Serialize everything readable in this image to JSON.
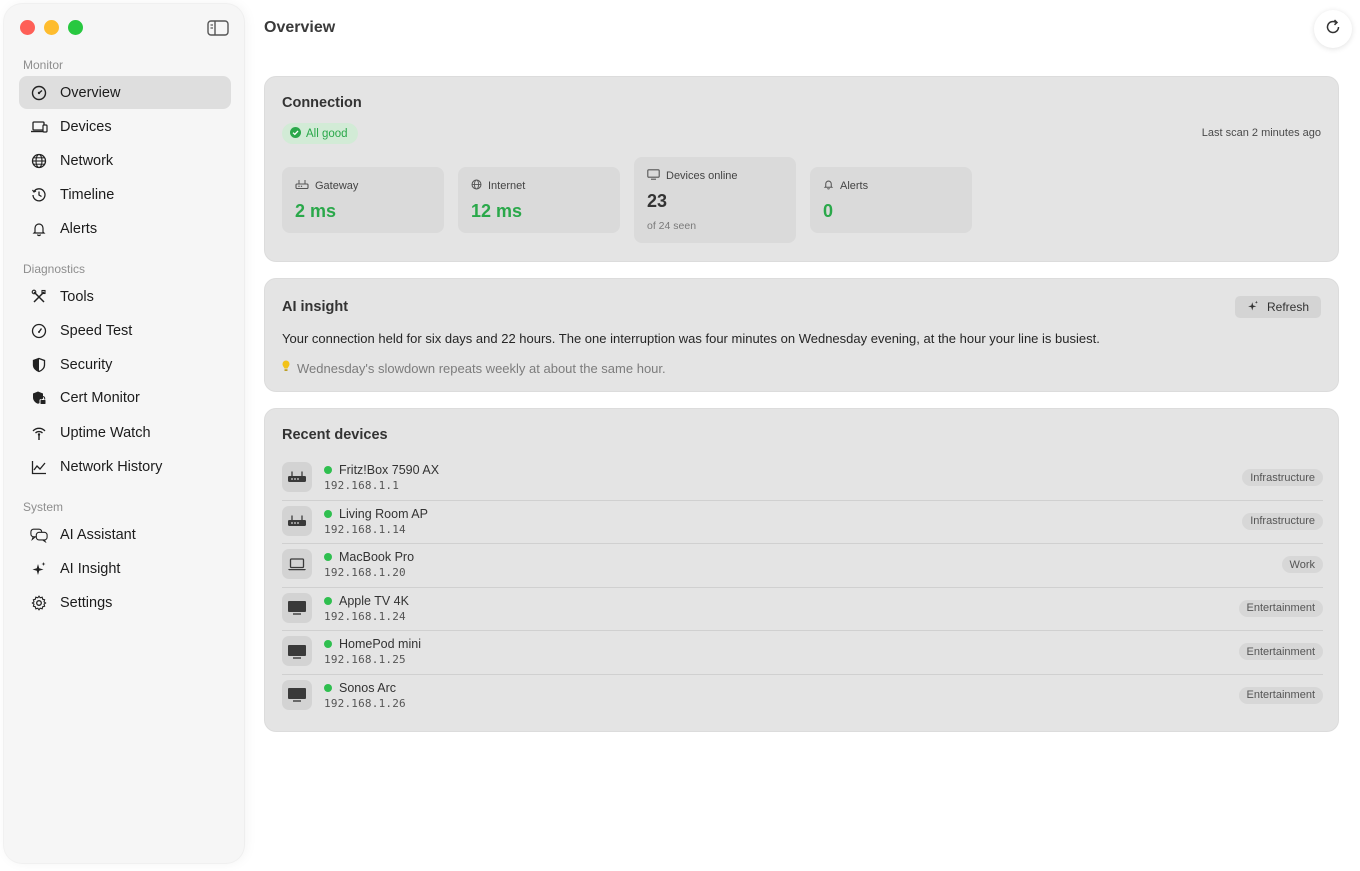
{
  "sidebar": {
    "sections": {
      "monitor": "Monitor",
      "diagnostics": "Diagnostics",
      "system": "System"
    },
    "items": [
      {
        "label": "Overview",
        "icon": "dashboard-icon",
        "active": true
      },
      {
        "label": "Devices",
        "icon": "devices-icon"
      },
      {
        "label": "Network",
        "icon": "globe-icon"
      },
      {
        "label": "Timeline",
        "icon": "history-icon"
      },
      {
        "label": "Alerts",
        "icon": "bell-icon"
      },
      {
        "label": "Tools",
        "icon": "tools-icon"
      },
      {
        "label": "Speed Test",
        "icon": "speedometer-icon"
      },
      {
        "label": "Security",
        "icon": "shield-icon"
      },
      {
        "label": "Cert Monitor",
        "icon": "shield-lock-icon"
      },
      {
        "label": "Uptime Watch",
        "icon": "antenna-icon"
      },
      {
        "label": "Network History",
        "icon": "line-chart-icon"
      },
      {
        "label": "AI Assistant",
        "icon": "chat-bubbles-icon"
      },
      {
        "label": "AI Insight",
        "icon": "sparkles-icon"
      },
      {
        "label": "Settings",
        "icon": "gear-icon"
      }
    ]
  },
  "header": {
    "title": "Overview"
  },
  "connection": {
    "title": "Connection",
    "status": "All good",
    "last_scan": "Last scan 2 minutes ago",
    "stats": {
      "gateway": {
        "label": "Gateway",
        "value": "2 ms"
      },
      "internet": {
        "label": "Internet",
        "value": "12 ms"
      },
      "devices_online": {
        "label": "Devices online",
        "value": "23",
        "sub": "of 24 seen"
      },
      "alerts": {
        "label": "Alerts",
        "value": "0"
      }
    }
  },
  "insight": {
    "title": "AI insight",
    "refresh_label": "Refresh",
    "text": "Your connection held for six days and 22 hours. The one interruption was four minutes on Wednesday evening, at the hour your line is busiest.",
    "tip": "Wednesday's slowdown repeats weekly at about the same hour."
  },
  "recent_devices": {
    "title": "Recent devices",
    "devices": [
      {
        "name": "Fritz!Box 7590 AX",
        "ip": "192.168.1.1",
        "tag": "Infrastructure",
        "icon": "router-icon"
      },
      {
        "name": "Living Room AP",
        "ip": "192.168.1.14",
        "tag": "Infrastructure",
        "icon": "router-icon"
      },
      {
        "name": "MacBook Pro",
        "ip": "192.168.1.20",
        "tag": "Work",
        "icon": "laptop-icon"
      },
      {
        "name": "Apple TV 4K",
        "ip": "192.168.1.24",
        "tag": "Entertainment",
        "icon": "tv-icon"
      },
      {
        "name": "HomePod mini",
        "ip": "192.168.1.25",
        "tag": "Entertainment",
        "icon": "tv-icon"
      },
      {
        "name": "Sonos Arc",
        "ip": "192.168.1.26",
        "tag": "Entertainment",
        "icon": "tv-icon"
      }
    ]
  },
  "colors": {
    "accent_green": "#2aa84a",
    "status_dot": "#2fbf4f",
    "card_bg": "#e4e4e4"
  }
}
